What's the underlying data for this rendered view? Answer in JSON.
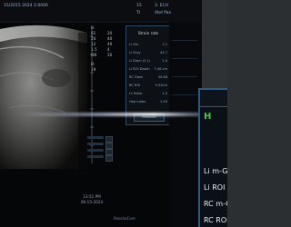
{
  "top_bar": {
    "date_line": "15/2015 2024 2:0006",
    "right_line_1": "15",
    "right_line_2": "TI",
    "right_label_1": "3. ECH",
    "right_label_2": "Abd Pan"
  },
  "params": [
    "B:",
    "61",
    "24",
    "12",
    "1.5",
    "GN",
    "B:",
    "19"
  ],
  "param_values": [
    "",
    "20",
    "40",
    "40",
    "4",
    "20",
    "",
    ""
  ],
  "overlay_panel": {
    "title": "Strain rate",
    "rows": [
      {
        "label": "Li Gm",
        "value": "1.1"
      },
      {
        "label": "Li Grey",
        "value": "43.7"
      },
      {
        "label": "Li Diam (0.1)",
        "value": "2.4"
      },
      {
        "label": "Li ROI Depth",
        "value": "7.48 cm"
      },
      {
        "label": "RC Diam",
        "value": "40.68"
      },
      {
        "label": "RC ROI",
        "value": "9.53cm"
      },
      {
        "label": "H. Ratio",
        "value": "1.0"
      },
      {
        "label": "Hep Index",
        "value": "1.49"
      }
    ],
    "button": "Measure"
  },
  "bottom": {
    "stamp_line_1": "13:51 PM",
    "stamp_line_2": "06-15-2024",
    "logo": "ResonaCore"
  },
  "right_card": {
    "highlight": "H",
    "rows": [
      "Li m-Gra",
      "Li ROI D",
      "RC m-G",
      "RC ROI"
    ]
  },
  "colors": {
    "accent": "#2b5b82",
    "highlight": "#4dc24d"
  }
}
